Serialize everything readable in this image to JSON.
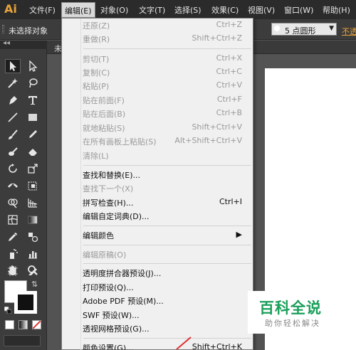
{
  "app": {
    "logo": "Ai",
    "logo_color": "#e8a33a"
  },
  "menubar": {
    "items": [
      "文件(F)",
      "编辑(E)",
      "对象(O)",
      "文字(T)",
      "选择(S)",
      "效果(C)",
      "视图(V)",
      "窗口(W)",
      "帮助(H)"
    ],
    "active": "编辑(E)"
  },
  "controlbar": {
    "selection_status": "未选择对象",
    "brush_size": "5 点圆形",
    "opacity_link": "不透"
  },
  "document": {
    "tab_label": "未"
  },
  "tools": {
    "active_tool": "selection-tool",
    "fill_color": "#ffffff",
    "stroke_color": "#000000"
  },
  "edit_menu": {
    "items": [
      {
        "label": "还原(Z)",
        "shortcut": "Ctrl+Z",
        "enabled": false
      },
      {
        "label": "重做(R)",
        "shortcut": "Shift+Ctrl+Z",
        "enabled": false
      },
      {
        "label": "剪切(T)",
        "shortcut": "Ctrl+X",
        "enabled": false
      },
      {
        "label": "复制(C)",
        "shortcut": "Ctrl+C",
        "enabled": false
      },
      {
        "label": "粘贴(P)",
        "shortcut": "Ctrl+V",
        "enabled": false
      },
      {
        "label": "贴在前面(F)",
        "shortcut": "Ctrl+F",
        "enabled": false
      },
      {
        "label": "贴在后面(B)",
        "shortcut": "Ctrl+B",
        "enabled": false
      },
      {
        "label": "就地粘贴(S)",
        "shortcut": "Shift+Ctrl+V",
        "enabled": false
      },
      {
        "label": "在所有画板上粘贴(S)",
        "shortcut": "Alt+Shift+Ctrl+V",
        "enabled": false
      },
      {
        "label": "清除(L)",
        "shortcut": "",
        "enabled": false
      },
      {
        "label": "查找和替换(E)...",
        "shortcut": "",
        "enabled": true
      },
      {
        "label": "查找下一个(X)",
        "shortcut": "",
        "enabled": false
      },
      {
        "label": "拼写检查(H)...",
        "shortcut": "Ctrl+I",
        "enabled": true
      },
      {
        "label": "编辑自定词典(D)...",
        "shortcut": "",
        "enabled": true
      },
      {
        "label": "编辑颜色",
        "shortcut": "",
        "enabled": true,
        "submenu": true
      },
      {
        "label": "编辑原稿(O)",
        "shortcut": "",
        "enabled": false
      },
      {
        "label": "透明度拼合器预设(J)...",
        "shortcut": "",
        "enabled": true
      },
      {
        "label": "打印预设(Q)...",
        "shortcut": "",
        "enabled": true
      },
      {
        "label": "Adobe PDF 预设(M)...",
        "shortcut": "",
        "enabled": true
      },
      {
        "label": "SWF 预设(W)...",
        "shortcut": "",
        "enabled": true
      },
      {
        "label": "透视网格预设(G)...",
        "shortcut": "",
        "enabled": true
      },
      {
        "label": "颜色设置(G)...",
        "shortcut": "Shift+Ctrl+K",
        "enabled": true
      }
    ]
  },
  "watermark": {
    "title": "百科全说",
    "subtitle": "助你轻松解决",
    "color": "#1a9f5a"
  }
}
